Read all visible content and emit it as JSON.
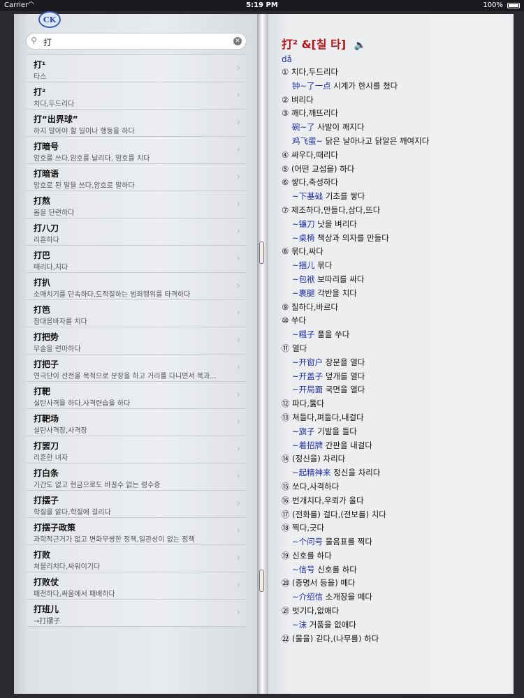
{
  "status_bar": {
    "carrier": "Carrier",
    "time": "5:19 PM",
    "battery": "100%"
  },
  "logo_text": "CK",
  "search": {
    "value": "打"
  },
  "results": [
    {
      "headword": "打¹",
      "def": "타스"
    },
    {
      "headword": "打²",
      "def": "치다,두드리다"
    },
    {
      "headword": "打“出界球”",
      "def": "하지 말아야 할 일이나 행동을 하다"
    },
    {
      "headword": "打暗号",
      "def": "암호를 쓰다,암호를 날리다, 암호를 치다"
    },
    {
      "headword": "打暗语",
      "def": "암호로 된 말을 쓰다,암호로 말하다"
    },
    {
      "headword": "打熬",
      "def": "몸을 단련하다"
    },
    {
      "headword": "打八刀",
      "def": "리혼하다"
    },
    {
      "headword": "打巴",
      "def": "때리다,치다"
    },
    {
      "headword": "打扒",
      "def": "소매치기를 단속하다,도적질하는 범죄행위를 타격하다"
    },
    {
      "headword": "打笆",
      "def": "참대올바자를 치다"
    },
    {
      "headword": "打把势",
      "def": "무술을 련마하다"
    },
    {
      "headword": "打把子",
      "def": "연극단이 선전을 목적으로 분장을 하고 거리를 다니면서 북과..."
    },
    {
      "headword": "打靶",
      "def": "실탄사격을 하다,사격련습을 하다"
    },
    {
      "headword": "打靶场",
      "def": "실탄사격장,사격장"
    },
    {
      "headword": "打罢刀",
      "def": "리혼한 녀자"
    },
    {
      "headword": "打白条",
      "def": "기간도 없고 현금으로도 바꿀수 없는 령수증"
    },
    {
      "headword": "打摆子",
      "def": "학질을 앓다,학질에 걸리다"
    },
    {
      "headword": "打摆子政策",
      "def": "과학적근거가 없고 변화무쌍한 정책,일관성이 없는 정책"
    },
    {
      "headword": "打败",
      "def": "쳐물리치다,싸워이기다"
    },
    {
      "headword": "打败仗",
      "def": "패전하다,싸움에서 패배하다"
    },
    {
      "headword": "打班儿",
      "def": "→打摆子"
    }
  ],
  "entry": {
    "title": "打² &[칠 타]",
    "pinyin": "dǎ",
    "lines": [
      {
        "type": "sense",
        "text": "① 치다,두드리다"
      },
      {
        "type": "ex",
        "zh": "钟~了一点",
        "ko": " 시계가 한시를 쳤다"
      },
      {
        "type": "sense",
        "text": "② 벼리다"
      },
      {
        "type": "sense",
        "text": "③ 깨다,깨뜨리다"
      },
      {
        "type": "ex",
        "zh": "碗~了",
        "ko": " 사발이 깨지다"
      },
      {
        "type": "ex",
        "zh": "鸡飞蛋~",
        "ko": " 닭은 날아나고 닭알은 깨여지다"
      },
      {
        "type": "sense",
        "text": "④ 싸우다,때리다"
      },
      {
        "type": "sense",
        "text": "⑤ (어떤 교섭을) 하다"
      },
      {
        "type": "sense",
        "text": "⑥ 쌓다,축성하다"
      },
      {
        "type": "ex",
        "zh": "~下基础",
        "ko": " 기초를 쌓다"
      },
      {
        "type": "sense",
        "text": "⑦ 제조하다,만들다,삼다,뜨다"
      },
      {
        "type": "ex",
        "zh": "~镰刀",
        "ko": " 낫을 벼리다"
      },
      {
        "type": "ex",
        "zh": "~桌椅",
        "ko": " 책상과 의자를 만들다"
      },
      {
        "type": "sense",
        "text": "⑧ 묶다,싸다"
      },
      {
        "type": "ex",
        "zh": "~捆儿",
        "ko": " 묶다"
      },
      {
        "type": "ex",
        "zh": "~包袱",
        "ko": " 보따리를 싸다"
      },
      {
        "type": "ex",
        "zh": "~裹腿",
        "ko": " 각반을 치다"
      },
      {
        "type": "sense",
        "text": "⑨ 칠하다,바르다"
      },
      {
        "type": "sense",
        "text": "⑩ 쑤다"
      },
      {
        "type": "ex",
        "zh": "~糨子",
        "ko": " 풀을 쑤다"
      },
      {
        "type": "sense",
        "text": "⑪ 열다"
      },
      {
        "type": "ex",
        "zh": "~开窗户",
        "ko": " 창문을 열다"
      },
      {
        "type": "ex",
        "zh": "~开盖子",
        "ko": " 덮개를 열다"
      },
      {
        "type": "ex",
        "zh": "~开局面",
        "ko": " 국면을 열다"
      },
      {
        "type": "sense",
        "text": "⑫ 파다,뚫다"
      },
      {
        "type": "sense",
        "text": "⑬ 쳐들다,펴들다,내걸다"
      },
      {
        "type": "ex",
        "zh": "~旗子",
        "ko": " 기발을 들다"
      },
      {
        "type": "ex",
        "zh": "~着招牌",
        "ko": " 간판을 내걸다"
      },
      {
        "type": "sense",
        "text": "⑭ (정신을) 차리다"
      },
      {
        "type": "ex",
        "zh": "~起精神来",
        "ko": " 정신을 차리다"
      },
      {
        "type": "sense",
        "text": "⑮ 쏘다,사격하다"
      },
      {
        "type": "sense",
        "text": "⑯ 번개치다,우뢰가 울다"
      },
      {
        "type": "sense",
        "text": "⑰ (전화를) 걸다,(전보를) 치다"
      },
      {
        "type": "sense",
        "text": "⑱ 찍다,긋다"
      },
      {
        "type": "ex",
        "zh": "~个问号",
        "ko": " 물음표를 찍다"
      },
      {
        "type": "sense",
        "text": "⑲ 신호를 하다"
      },
      {
        "type": "ex",
        "zh": "~信号",
        "ko": " 신호를 하다"
      },
      {
        "type": "sense",
        "text": "⑳ (증명서 등을) 떼다"
      },
      {
        "type": "ex",
        "zh": "~介绍信",
        "ko": " 소개장을 떼다"
      },
      {
        "type": "sense",
        "text": "㉑ 벗기다,없애다"
      },
      {
        "type": "ex",
        "zh": "~沫",
        "ko": " 거품을 없애다"
      },
      {
        "type": "sense",
        "text": "㉒ (물을) 긷다,(나무를) 하다"
      }
    ]
  }
}
